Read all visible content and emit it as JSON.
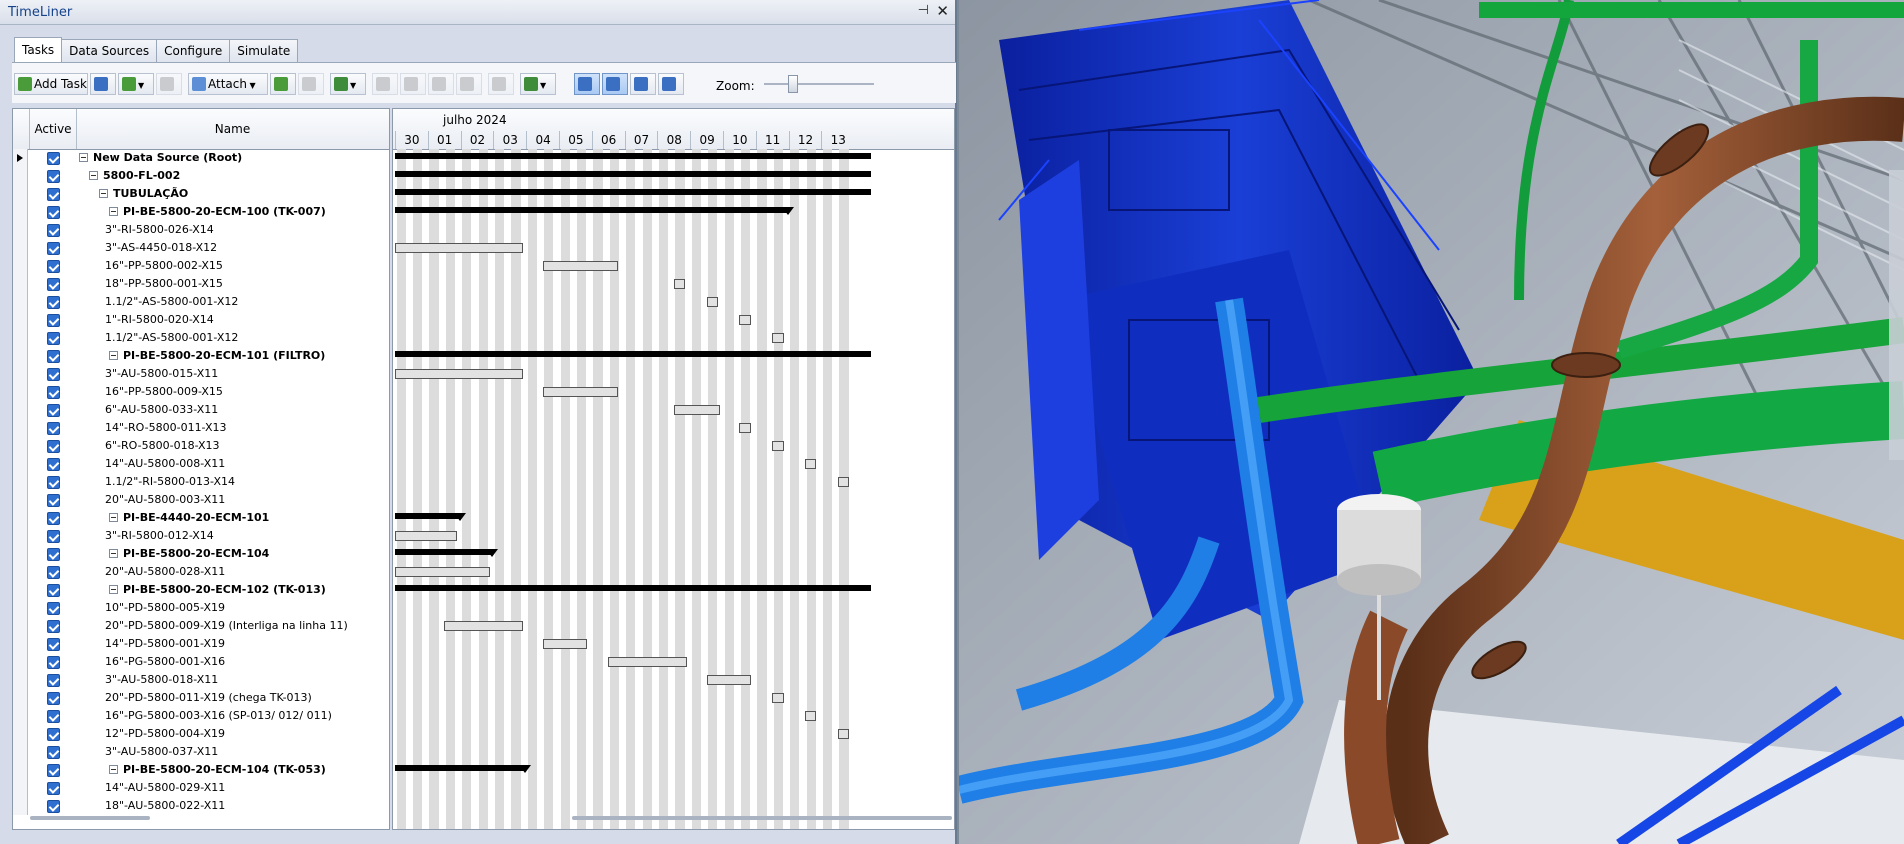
{
  "window": {
    "title": "TimeLiner"
  },
  "tabs": [
    "Tasks",
    "Data Sources",
    "Configure",
    "Simulate"
  ],
  "toolbar": {
    "add_task": "Add Task",
    "attach": "Attach",
    "zoom_label": "Zoom:"
  },
  "columns": {
    "active": "Active",
    "name": "Name"
  },
  "gantt": {
    "month": "julho 2024",
    "days": [
      "30",
      "01",
      "02",
      "03",
      "04",
      "05",
      "06",
      "07",
      "08",
      "09",
      "10",
      "11",
      "12",
      "13"
    ]
  },
  "rows": [
    {
      "name": "New Data Source (Root)",
      "level": 0,
      "bold": true,
      "expand": true
    },
    {
      "name": "5800-FL-002",
      "level": 1,
      "bold": true,
      "expand": true
    },
    {
      "name": "TUBULAÇÃO",
      "level": 2,
      "bold": true,
      "expand": true
    },
    {
      "name": "PI-BE-5800-20-ECM-100 (TK-007)",
      "level": 3,
      "bold": true,
      "expand": true
    },
    {
      "name": "3\"-RI-5800-026-X14",
      "level": 4
    },
    {
      "name": "3\"-AS-4450-018-X12",
      "level": 4
    },
    {
      "name": "16\"-PP-5800-002-X15",
      "level": 4
    },
    {
      "name": "18\"-PP-5800-001-X15",
      "level": 4
    },
    {
      "name": "1.1/2\"-AS-5800-001-X12",
      "level": 4
    },
    {
      "name": "1\"-RI-5800-020-X14",
      "level": 4
    },
    {
      "name": "1.1/2\"-AS-5800-001-X12",
      "level": 4
    },
    {
      "name": "PI-BE-5800-20-ECM-101 (FILTRO)",
      "level": 3,
      "bold": true,
      "expand": true
    },
    {
      "name": "3\"-AU-5800-015-X11",
      "level": 4
    },
    {
      "name": "16\"-PP-5800-009-X15",
      "level": 4
    },
    {
      "name": "6\"-AU-5800-033-X11",
      "level": 4
    },
    {
      "name": "14\"-RO-5800-011-X13",
      "level": 4
    },
    {
      "name": "6\"-RO-5800-018-X13",
      "level": 4
    },
    {
      "name": "14\"-AU-5800-008-X11",
      "level": 4
    },
    {
      "name": "1.1/2\"-RI-5800-013-X14",
      "level": 4
    },
    {
      "name": "20\"-AU-5800-003-X11",
      "level": 4
    },
    {
      "name": "PI-BE-4440-20-ECM-101",
      "level": 3,
      "bold": true,
      "expand": true
    },
    {
      "name": "3\"-RI-5800-012-X14",
      "level": 4
    },
    {
      "name": "PI-BE-5800-20-ECM-104",
      "level": 3,
      "bold": true,
      "expand": true
    },
    {
      "name": "20\"-AU-5800-028-X11",
      "level": 4
    },
    {
      "name": "PI-BE-5800-20-ECM-102 (TK-013)",
      "level": 3,
      "bold": true,
      "expand": true
    },
    {
      "name": "10\"-PD-5800-005-X19",
      "level": 4
    },
    {
      "name": "20\"-PD-5800-009-X19 (Interliga na linha 11)",
      "level": 4
    },
    {
      "name": "14\"-PD-5800-001-X19",
      "level": 4
    },
    {
      "name": "16\"-PG-5800-001-X16",
      "level": 4
    },
    {
      "name": "3\"-AU-5800-018-X11",
      "level": 4
    },
    {
      "name": "20\"-PD-5800-011-X19 (chega TK-013)",
      "level": 4
    },
    {
      "name": "16\"-PG-5800-003-X16 (SP-013/ 012/ 011)",
      "level": 4
    },
    {
      "name": "12\"-PD-5800-004-X19",
      "level": 4
    },
    {
      "name": "3\"-AU-5800-037-X11",
      "level": 4
    },
    {
      "name": "PI-BE-5800-20-ECM-104 (TK-053)",
      "level": 3,
      "bold": true,
      "expand": true
    },
    {
      "name": "14\"-AU-5800-029-X11",
      "level": 4
    },
    {
      "name": "18\"-AU-5800-022-X11",
      "level": 4
    }
  ],
  "bars": [
    {
      "row": 0,
      "start": 0,
      "end": 14.5,
      "summary": true
    },
    {
      "row": 1,
      "start": 0,
      "end": 14.5,
      "summary": true
    },
    {
      "row": 2,
      "start": 0,
      "end": 14.5,
      "summary": true
    },
    {
      "row": 3,
      "start": 0,
      "end": 12,
      "summary": true,
      "tip": true
    },
    {
      "row": 5,
      "start": 0,
      "end": 3.9
    },
    {
      "row": 6,
      "start": 4.5,
      "end": 6.8
    },
    {
      "row": 7,
      "start": 8.5,
      "end": 8.85
    },
    {
      "row": 8,
      "start": 9.5,
      "end": 9.85
    },
    {
      "row": 9,
      "start": 10.5,
      "end": 10.85
    },
    {
      "row": 10,
      "start": 11.5,
      "end": 11.85
    },
    {
      "row": 11,
      "start": 0,
      "end": 14.5,
      "summary": true
    },
    {
      "row": 12,
      "start": 0,
      "end": 3.9
    },
    {
      "row": 13,
      "start": 4.5,
      "end": 6.8
    },
    {
      "row": 14,
      "start": 8.5,
      "end": 9.9
    },
    {
      "row": 15,
      "start": 10.5,
      "end": 10.85
    },
    {
      "row": 16,
      "start": 11.5,
      "end": 11.85
    },
    {
      "row": 17,
      "start": 12.5,
      "end": 12.85
    },
    {
      "row": 18,
      "start": 13.5,
      "end": 13.85
    },
    {
      "row": 20,
      "start": 0,
      "end": 2,
      "summary": true,
      "tip": true
    },
    {
      "row": 21,
      "start": 0,
      "end": 1.9
    },
    {
      "row": 22,
      "start": 0,
      "end": 3,
      "summary": true,
      "tip": true
    },
    {
      "row": 23,
      "start": 0,
      "end": 2.9
    },
    {
      "row": 24,
      "start": 0,
      "end": 14.5,
      "summary": true
    },
    {
      "row": 26,
      "start": 1.5,
      "end": 3.9
    },
    {
      "row": 27,
      "start": 4.5,
      "end": 5.85
    },
    {
      "row": 28,
      "start": 6.5,
      "end": 8.9
    },
    {
      "row": 29,
      "start": 9.5,
      "end": 10.85
    },
    {
      "row": 30,
      "start": 11.5,
      "end": 11.85
    },
    {
      "row": 31,
      "start": 12.5,
      "end": 12.85
    },
    {
      "row": 32,
      "start": 13.5,
      "end": 13.85
    },
    {
      "row": 34,
      "start": 0,
      "end": 4,
      "summary": true,
      "tip": true
    }
  ],
  "icons": [
    "add-task-icon",
    "insert-icon",
    "auto-add-icon",
    "delete-icon",
    "attach-icon",
    "refresh-icon",
    "clear-icon",
    "find-icon",
    "indent-icon",
    "outdent-icon",
    "move-up-icon",
    "move-down-icon",
    "comment-icon",
    "columns-icon",
    "view-icon"
  ],
  "colors": {
    "active_check": "#2f6fd0",
    "accent": "#15428b"
  }
}
